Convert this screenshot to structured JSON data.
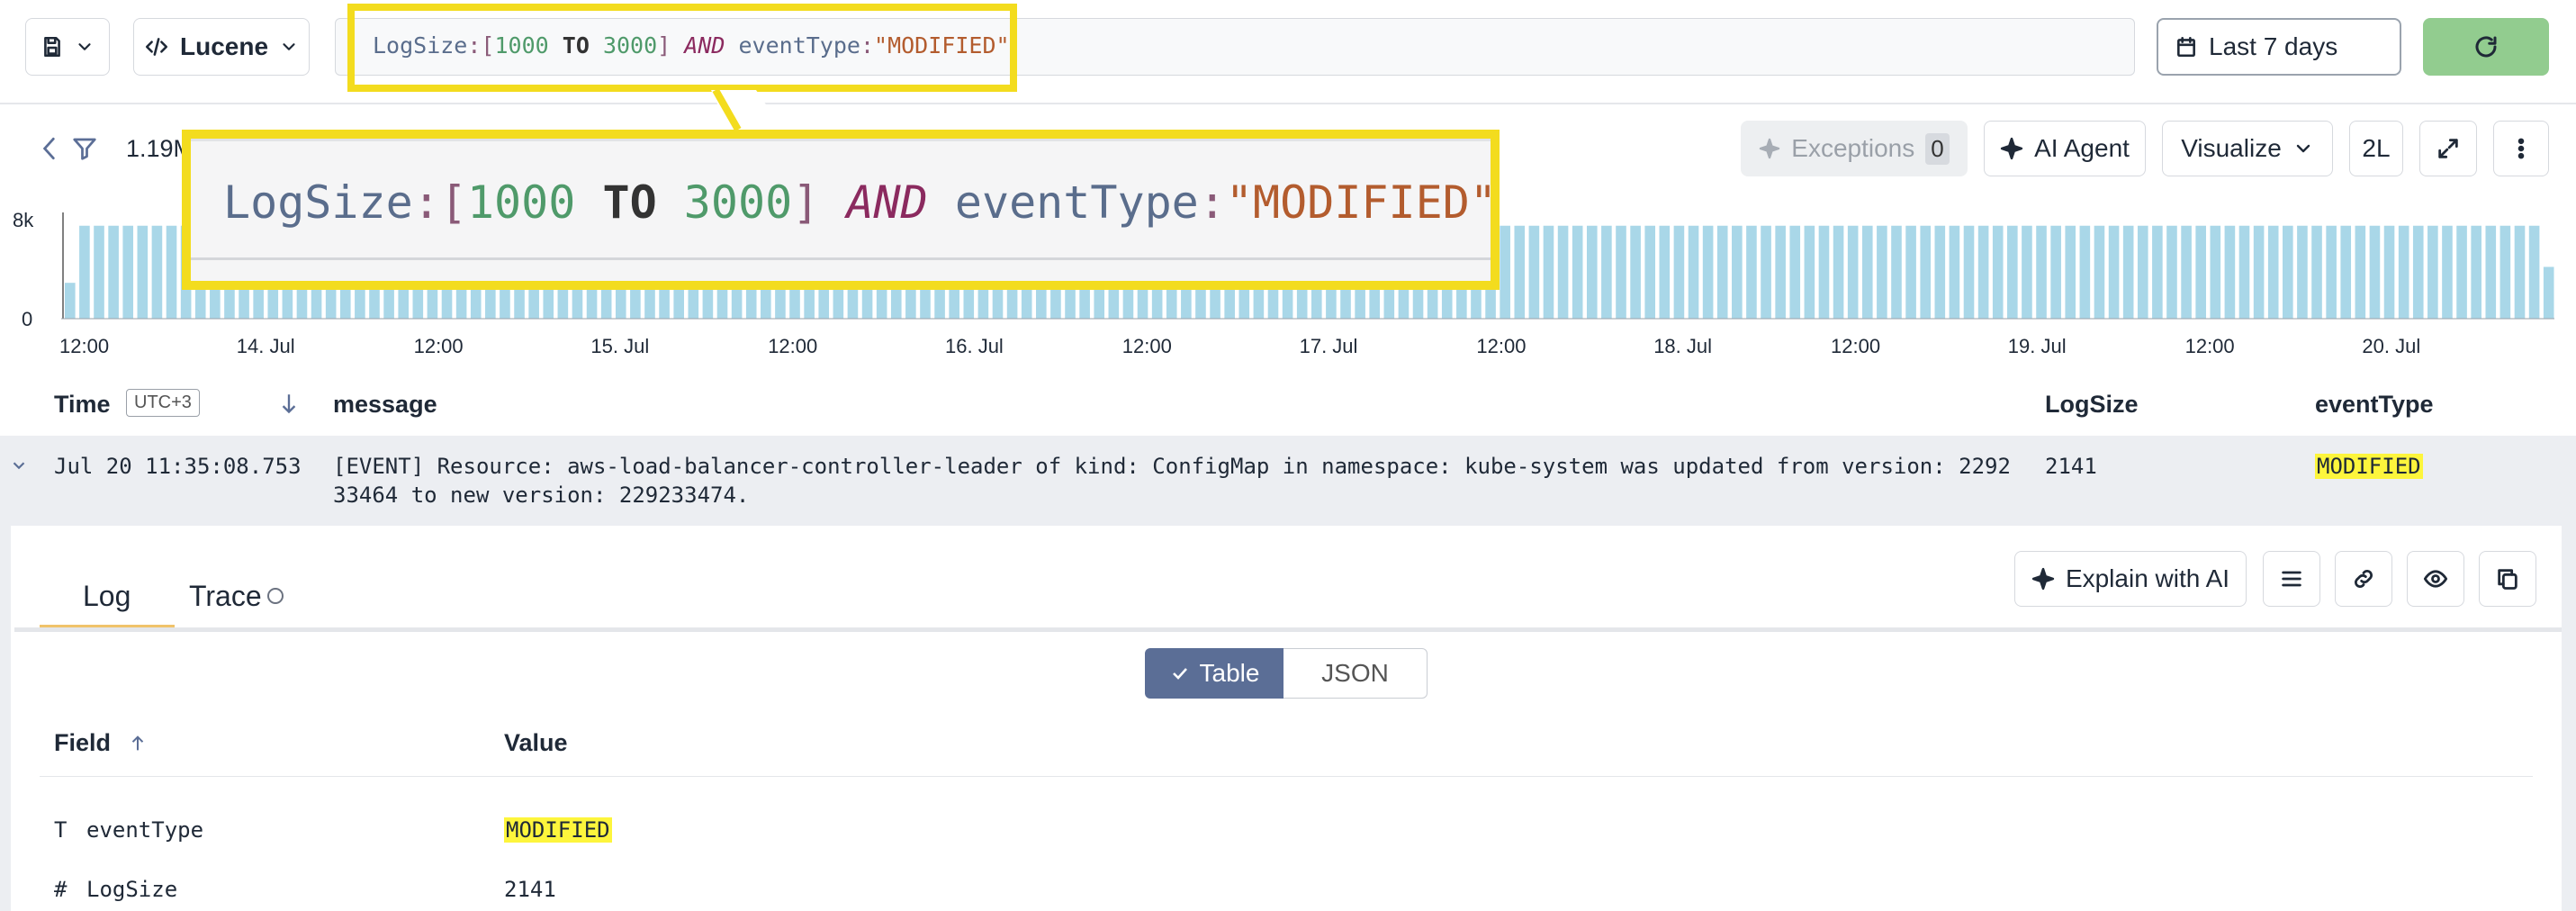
{
  "toolbar": {
    "save_icon": "save-icon",
    "language_label": "Lucene",
    "query_tokens": {
      "field1": "LogSize",
      "colon": ":",
      "open": "[",
      "from": "1000",
      "to_kw": "TO",
      "to": "3000",
      "close": "]",
      "and": "AND",
      "field2": "eventType",
      "value": "\"MODIFIED\""
    },
    "time_range": "Last 7 days",
    "refresh_icon": "refresh-icon"
  },
  "summary": {
    "count_label": "1.19M"
  },
  "actions": {
    "exceptions_label": "Exceptions",
    "exceptions_count": "0",
    "ai_agent_label": "AI Agent",
    "visualize_label": "Visualize",
    "density_label": "2L"
  },
  "chart_data": {
    "type": "bar",
    "y_ticks": [
      "8k",
      "0"
    ],
    "x_tick_labels": [
      "12:00",
      "14. Jul",
      "12:00",
      "15. Jul",
      "12:00",
      "16. Jul",
      "12:00",
      "17. Jul",
      "12:00",
      "18. Jul",
      "12:00",
      "19. Jul",
      "12:00",
      "20. Jul"
    ],
    "ylim": [
      0,
      8000
    ],
    "bar_count": 168,
    "values_note_excluded": true,
    "values": [
      2700,
      7000,
      7000,
      7000,
      7000,
      7000,
      7000,
      7000,
      7000,
      7000,
      7000,
      7000,
      7000,
      7000,
      7000,
      7000,
      7000,
      7000,
      7000,
      7000,
      7000,
      7000,
      7000,
      7000,
      7000,
      7000,
      7000,
      7000,
      7000,
      7000,
      7000,
      7000,
      7000,
      7000,
      7000,
      7000,
      7000,
      7000,
      7000,
      7000,
      7000,
      7000,
      7000,
      7000,
      7000,
      7000,
      7000,
      7000,
      7000,
      7000,
      7000,
      7000,
      7000,
      7000,
      7000,
      7000,
      7000,
      7000,
      7000,
      7000,
      7000,
      7000,
      7000,
      7000,
      7000,
      7000,
      7000,
      7000,
      7000,
      7000,
      7000,
      7000,
      7000,
      7000,
      7000,
      7000,
      7000,
      7000,
      7000,
      7000,
      7000,
      7000,
      7000,
      7000,
      7000,
      7000,
      7000,
      7000,
      7000,
      7000,
      7000,
      7000,
      7000,
      7000,
      7000,
      7000,
      7000,
      7000,
      7000,
      7000,
      7000,
      7000,
      7000,
      7000,
      7000,
      7000,
      7000,
      7000,
      7000,
      7000,
      7000,
      7000,
      7000,
      7000,
      7000,
      7000,
      7000,
      7000,
      7000,
      7000,
      7000,
      7000,
      7000,
      7000,
      7000,
      7000,
      7000,
      7000,
      7000,
      7000,
      7000,
      7000,
      7000,
      7000,
      7000,
      7000,
      7000,
      7000,
      7000,
      7000,
      7000,
      7000,
      7000,
      7000,
      7000,
      7000,
      7000,
      7000,
      7000,
      7000,
      7000,
      7000,
      7000,
      7000,
      7000,
      7000,
      7000,
      7000,
      7000,
      7000,
      7000,
      7000,
      7000,
      7000,
      7000,
      7000,
      7000,
      7000,
      7000,
      7000,
      7000,
      3900
    ],
    "bar_color": "#a9d7e8"
  },
  "columns": {
    "time": "Time",
    "timezone": "UTC+3",
    "message": "message",
    "logsize": "LogSize",
    "eventtype": "eventType"
  },
  "log_row": {
    "time": "Jul 20 11:35:08.753",
    "message_line1": "[EVENT] Resource: aws-load-balancer-controller-leader of kind: ConfigMap in namespace: kube-system was updated from version: 2292",
    "message_line2": "33464 to new version: 229233474.",
    "logsize": "2141",
    "eventtype": "MODIFIED"
  },
  "detail": {
    "tabs": [
      "Log",
      "Trace"
    ],
    "explain_label": "Explain with AI",
    "view_toggle": [
      "Table",
      "JSON"
    ],
    "field_header": "Field",
    "value_header": "Value",
    "fields": [
      {
        "type_icon": "T",
        "name": "eventType",
        "value": "MODIFIED"
      },
      {
        "type_icon": "#",
        "name": "LogSize",
        "value": "2141"
      }
    ]
  },
  "colors": {
    "highlight": "#f3dc1e",
    "refresh_bg": "#92cc8f",
    "mark": "#fdf53c",
    "tab_underline": "#f0c36a",
    "toggle_active": "#5b6e96"
  }
}
